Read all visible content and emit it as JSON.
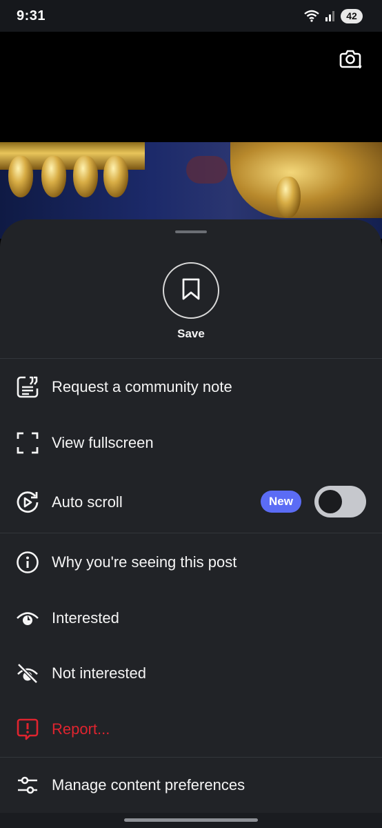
{
  "status_bar": {
    "time": "9:31",
    "battery": "42"
  },
  "sheet": {
    "save_label": "Save",
    "items": [
      {
        "label": "Request a community note",
        "icon": "community-note-icon"
      },
      {
        "label": "View fullscreen",
        "icon": "fullscreen-icon"
      },
      {
        "label": "Auto scroll",
        "icon": "auto-scroll-icon",
        "badge": "New",
        "toggle_on": false
      },
      {
        "label": "Why you're seeing this post",
        "icon": "info-icon"
      },
      {
        "label": "Interested",
        "icon": "eye-icon"
      },
      {
        "label": "Not interested",
        "icon": "eye-off-icon"
      },
      {
        "label": "Report...",
        "icon": "report-icon",
        "color": "#e0242f"
      },
      {
        "label": "Manage content preferences",
        "icon": "sliders-icon"
      }
    ]
  },
  "colors": {
    "sheet_bg": "#212327",
    "badge_bg": "#5b6cf5",
    "danger": "#e0242f"
  }
}
